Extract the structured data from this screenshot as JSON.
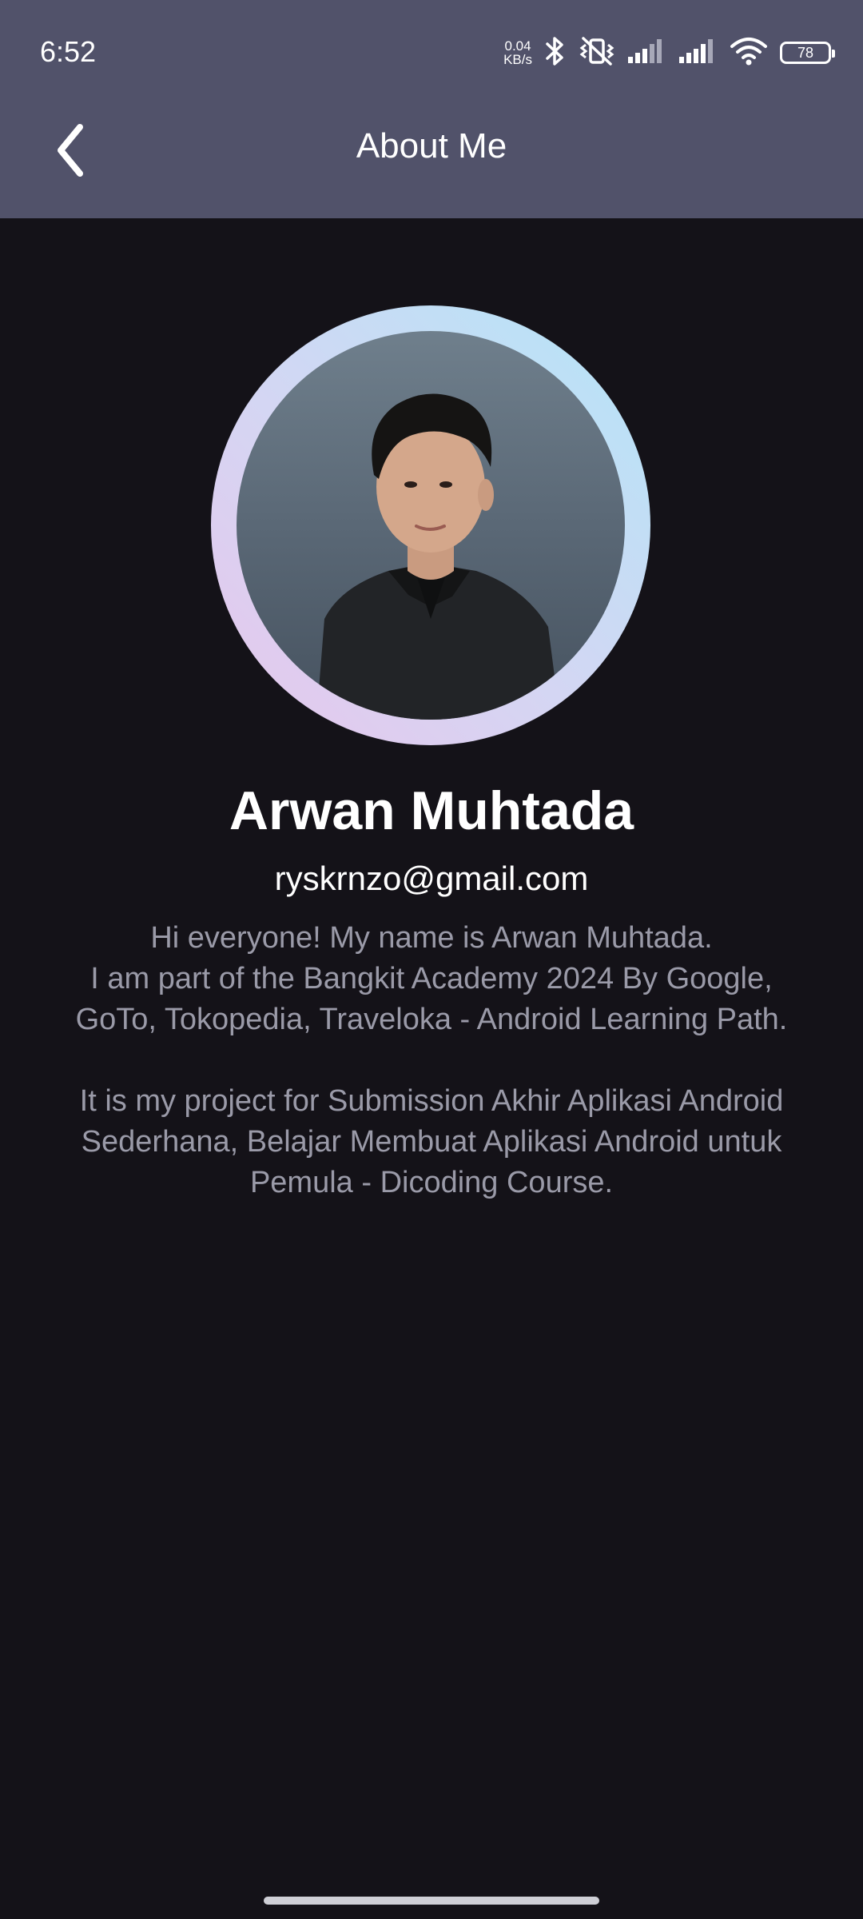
{
  "status_bar": {
    "time": "6:52",
    "net_speed_value": "0.04",
    "net_speed_unit": "KB/s",
    "battery": "78",
    "icons": [
      "bluetooth-icon",
      "mute-vibrate-icon",
      "signal-icon",
      "signal-icon",
      "wifi-icon",
      "battery-icon"
    ]
  },
  "app_bar": {
    "title": "About Me",
    "back_icon": "chevron-left-icon"
  },
  "profile": {
    "name": "Arwan Muhtada",
    "email": "ryskrnzo@gmail.com",
    "bio_lines": [
      "Hi everyone! My name is Arwan Muhtada.",
      "I am part of the Bangkit Academy 2024 By Google,",
      "GoTo, Tokopedia, Traveloka - Android Learning Path.",
      "",
      "It is my project for Submission Akhir Aplikasi Android",
      "Sederhana, Belajar Membuat Aplikasi Android untuk",
      "Pemula - Dicoding Course."
    ]
  },
  "colors": {
    "app_bar": "#51526a",
    "background": "#141218",
    "bio_text": "#9a9aa8",
    "ring_start": "#e7c6ec",
    "ring_end": "#b3e5f7"
  }
}
